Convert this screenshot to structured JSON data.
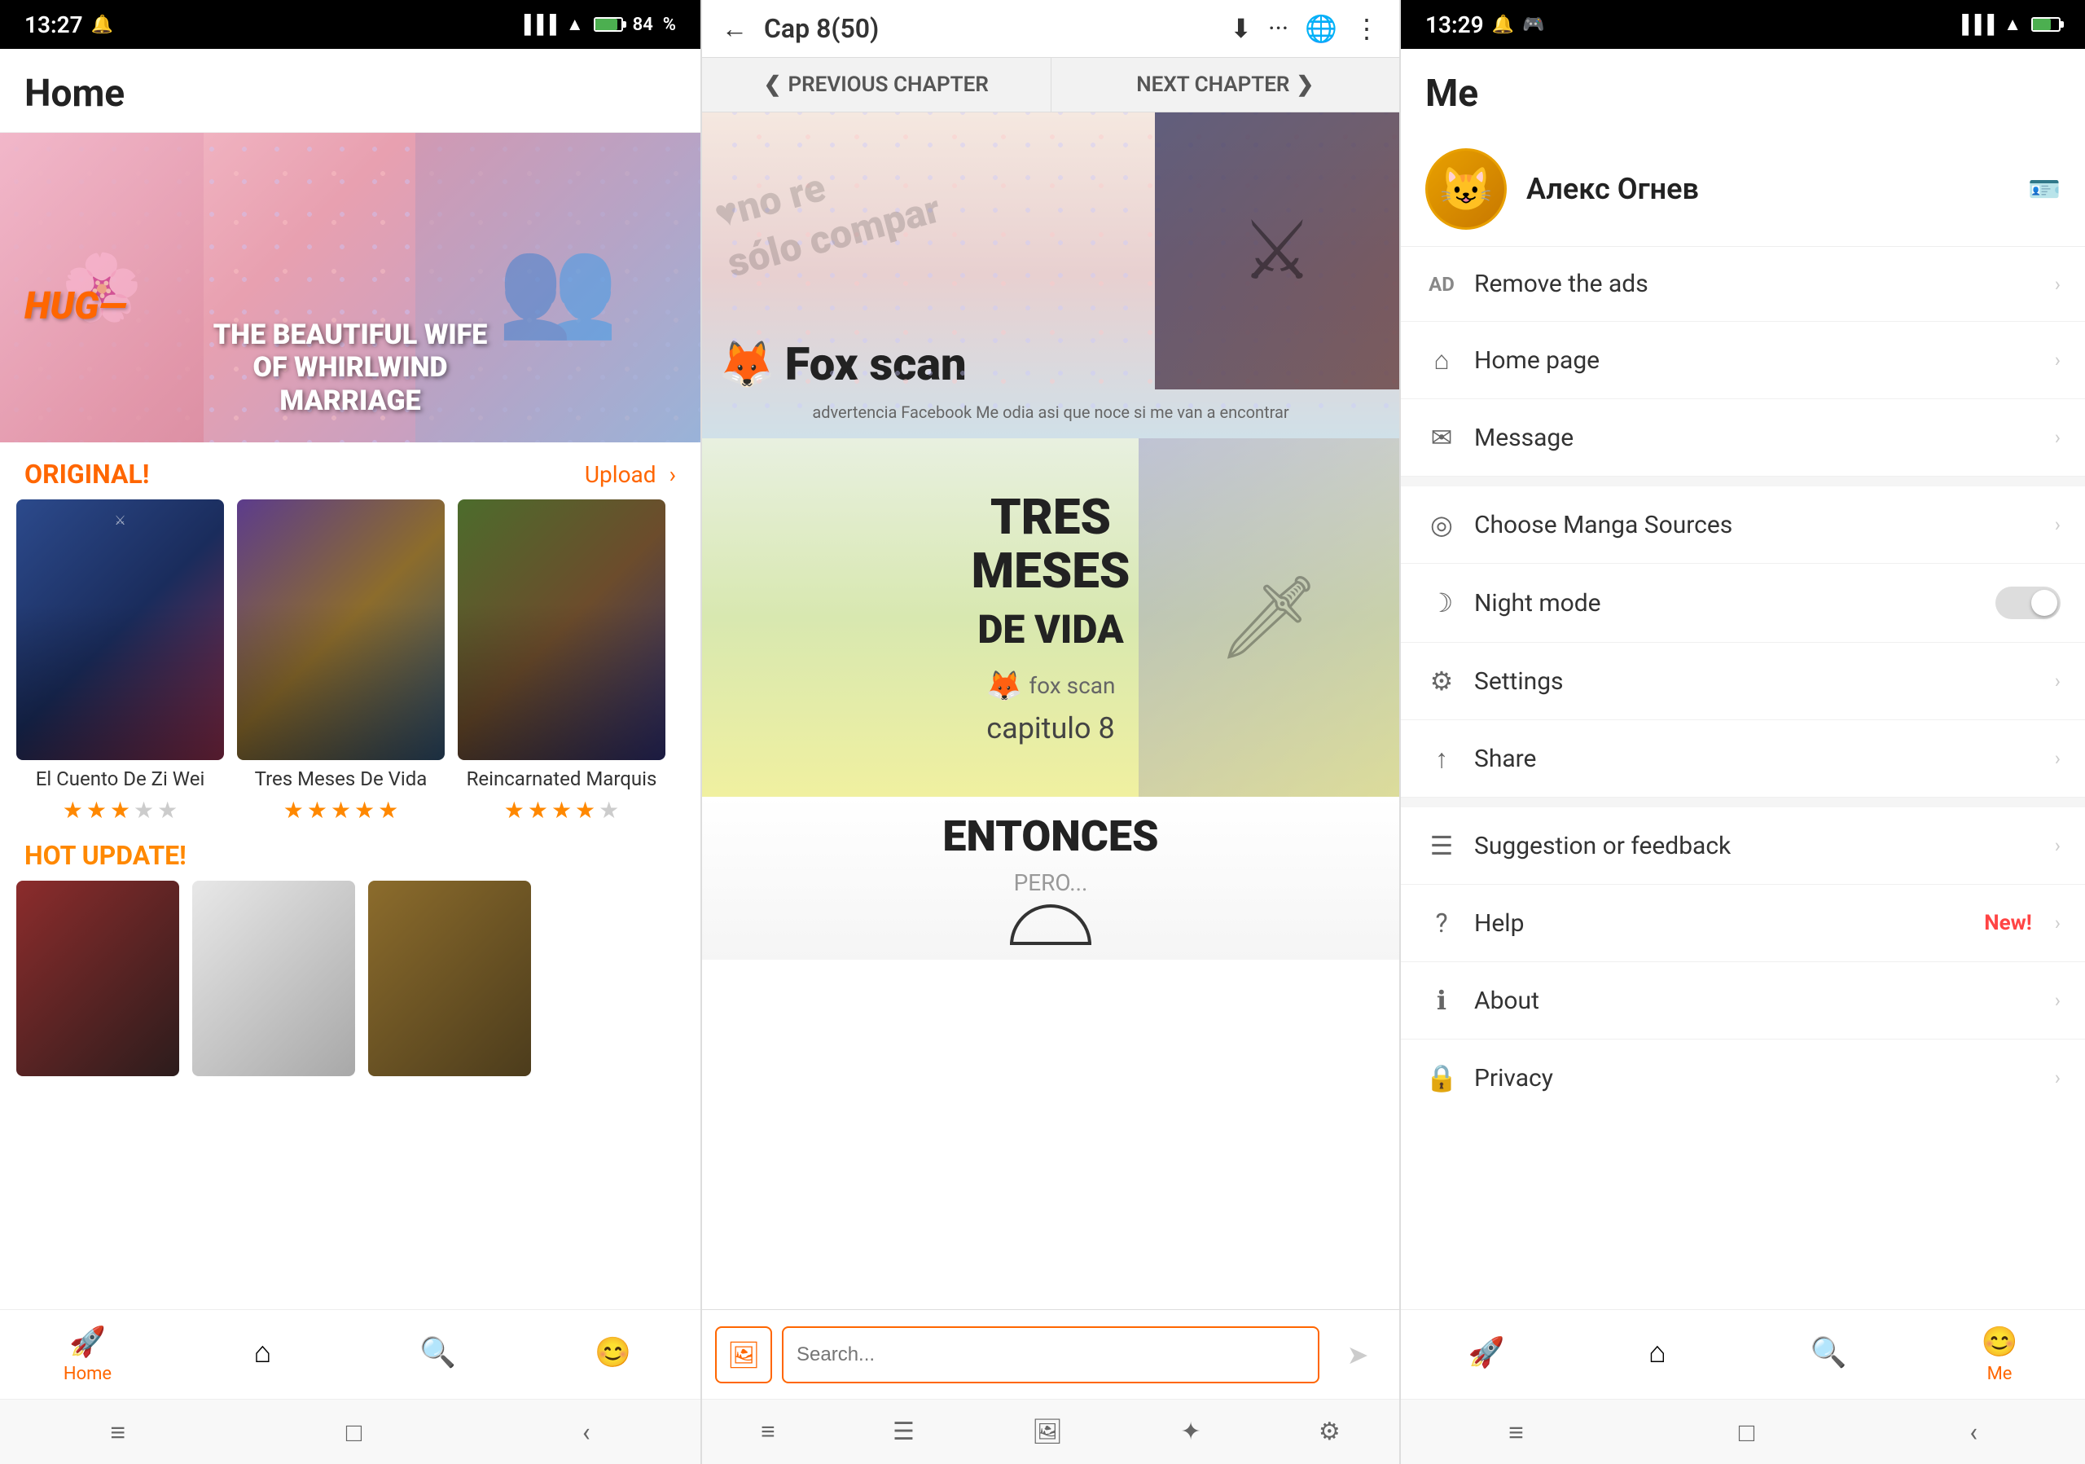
{
  "panel_home": {
    "status_bar": {
      "time": "13:27",
      "battery": "84"
    },
    "title": "Home",
    "section_original": "ORIGINAL!",
    "section_upload": "Upload",
    "manga_list": [
      {
        "title": "El Cuento De Zi Wei",
        "stars_full": 3,
        "stars_half": 0,
        "stars_empty": 2
      },
      {
        "title": "Tres Meses De Vida",
        "stars_full": 5,
        "stars_half": 0,
        "stars_empty": 0
      },
      {
        "title": "Reincarnated Marquis",
        "stars_full": 3,
        "stars_half": 1,
        "stars_empty": 1
      }
    ],
    "section_hot": "HOT UPDATE!",
    "nav_items": [
      {
        "label": "Home",
        "active": true
      },
      {
        "label": "",
        "active": false
      },
      {
        "label": "",
        "active": false
      },
      {
        "label": "",
        "active": false
      }
    ]
  },
  "panel_reader": {
    "status_bar": {
      "time": ""
    },
    "chapter": "Cap 8(50)",
    "prev_chapter": "PREVIOUS CHAPTER",
    "next_chapter": "NEXT CHAPTER",
    "page1": {
      "watermark_line1": "♥no re",
      "watermark_line2": "sólo compar",
      "fox_scan_label": "Fox scan",
      "fox_scan_sub": "advertencia Facebook Me odia asi que noce si me van a encontrar"
    },
    "page2": {
      "title_line1": "TRES",
      "title_line2": "MESES",
      "title_line3": "DE VIDA",
      "fox_scan_small": "fox scan",
      "capitulo": "capitulo 8"
    },
    "page3": {
      "text": "ENTONCES"
    },
    "search_placeholder": "Search...",
    "system_btns": [
      "≡",
      "⊟",
      "◻",
      "✦",
      "⚙"
    ]
  },
  "panel_me": {
    "status_bar": {
      "time": "13:29"
    },
    "title": "Me",
    "username": "Алекс Огнев",
    "menu_items": [
      {
        "icon": "AD",
        "label": "Remove the ads",
        "has_arrow": true,
        "type": "ad"
      },
      {
        "icon": "⌂",
        "label": "Home page",
        "has_arrow": true
      },
      {
        "icon": "✉",
        "label": "Message",
        "has_arrow": true
      },
      {
        "icon": "◎",
        "label": "Choose Manga Sources",
        "has_arrow": true
      },
      {
        "icon": "☽",
        "label": "Night mode",
        "has_toggle": true
      },
      {
        "icon": "⚙",
        "label": "Settings",
        "has_arrow": true
      },
      {
        "icon": "↑",
        "label": "Share",
        "has_arrow": true
      },
      {
        "icon": "☰",
        "label": "Suggestion or feedback",
        "has_arrow": true
      },
      {
        "icon": "?",
        "label": "Help",
        "badge": "New!",
        "has_arrow": true
      },
      {
        "icon": "ℹ",
        "label": "About",
        "has_arrow": true
      },
      {
        "icon": "🔒",
        "label": "Privacy",
        "has_arrow": true
      }
    ],
    "nav_items": [
      {
        "label": "",
        "active": false
      },
      {
        "label": "",
        "active": false
      },
      {
        "label": "",
        "active": false
      },
      {
        "label": "Me",
        "active": true
      }
    ]
  }
}
